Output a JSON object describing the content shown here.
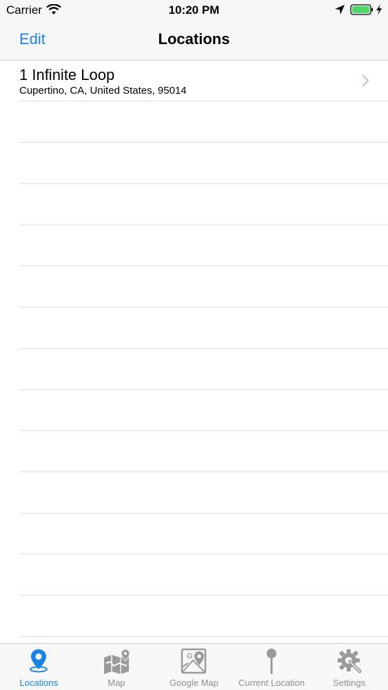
{
  "status_bar": {
    "carrier": "Carrier",
    "time": "10:20 PM"
  },
  "nav": {
    "edit_label": "Edit",
    "title": "Locations"
  },
  "locations": [
    {
      "title": "1 Infinite Loop",
      "subtitle": "Cupertino, CA, United States, 95014"
    }
  ],
  "tabs": [
    {
      "label": "Locations",
      "icon": "location-pin-icon",
      "active": true
    },
    {
      "label": "Map",
      "icon": "folded-map-icon",
      "active": false
    },
    {
      "label": "Google Map",
      "icon": "google-map-icon",
      "active": false
    },
    {
      "label": "Current Location",
      "icon": "pushpin-icon",
      "active": false
    },
    {
      "label": "Settings",
      "icon": "gear-wrench-icon",
      "active": false
    }
  ],
  "colors": {
    "accent": "#1a82e2",
    "inactive": "#8e8e8e",
    "battery": "#4cd964"
  }
}
